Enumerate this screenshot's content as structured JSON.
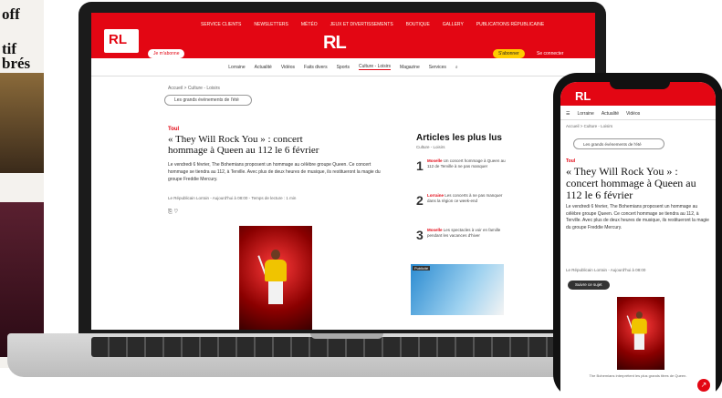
{
  "background": {
    "headlines": [
      "off",
      "tif",
      "brés"
    ]
  },
  "site": {
    "logo": "RL",
    "top_links": [
      "SERVICE CLIENTS",
      "NEWSLETTERS",
      "MÉTÉO",
      "JEUX ET DIVERTISSEMENTS",
      "BOUTIQUE",
      "GALLERY",
      "PUBLICATIONS RÉPUBLICAINE"
    ],
    "subscribe_left": "Je m'abonne",
    "subscribe_right": "S'abonner",
    "login": "Se connecter",
    "nav": [
      "Lorraine",
      "Actualité",
      "Vidéos",
      "Faits divers",
      "Sports",
      "Culture - Loisirs",
      "Magazine",
      "Services"
    ],
    "breadcrumb": "Accueil > Culture - Loisirs",
    "search": "Les grands événements de l'été"
  },
  "article": {
    "category": "Toul",
    "title": "« They Will Rock You » : concert hommage à Queen au 112 le 6 février",
    "lead": "Le vendredi 6 février, The Bohemians proposent un hommage au célèbre groupe Queen. Ce concert hommage se tiendra au 112, à Terville. Avec plus de deux heures de musique, ils restitueront la magie du groupe Freddie Mercury.",
    "byline": "Le Républicain Lorrain - Aujourd'hui à 08:00 - Temps de lecture : 1 min",
    "share": "⎘ ♡"
  },
  "aside": {
    "title": "Articles les plus lus",
    "subtitle": "Culture - Loisirs",
    "items": [
      {
        "num": "1",
        "tag": "Moselle",
        "text": "Un concert hommage à Queen au 112 de Terville à ne pas manquer"
      },
      {
        "num": "2",
        "tag": "Lorraine",
        "text": "Les concerts à ne pas manquer dans la région ce week-end"
      },
      {
        "num": "3",
        "tag": "Moselle",
        "text": "Les spectacles à voir en famille pendant les vacances d'hiver"
      }
    ],
    "ad_label": "Publicité"
  },
  "phone": {
    "logo": "RL",
    "nav": [
      "Lorraine",
      "Actualité",
      "Vidéos"
    ],
    "breadcrumb": "Accueil > Culture - Loisirs",
    "search": "Les grands événements de l'été",
    "category": "Toul",
    "title": "« They Will Rock You » : concert hommage à Queen au 112 le 6 février",
    "lead": "Le vendredi 6 février, The Bohemians proposent un hommage au célèbre groupe Queen. Ce concert hommage se tiendra au 112, à Terville. Avec plus de deux heures de musique, ils restitueront la magie du groupe Freddie Mercury.",
    "byline": "Le Républicain Lorrain - Aujourd'hui à 08:00",
    "follow": "Suivre ce sujet",
    "caption": "The Bohemians interprètent les plus grands titres de Queen.",
    "share_icon": "↗"
  }
}
